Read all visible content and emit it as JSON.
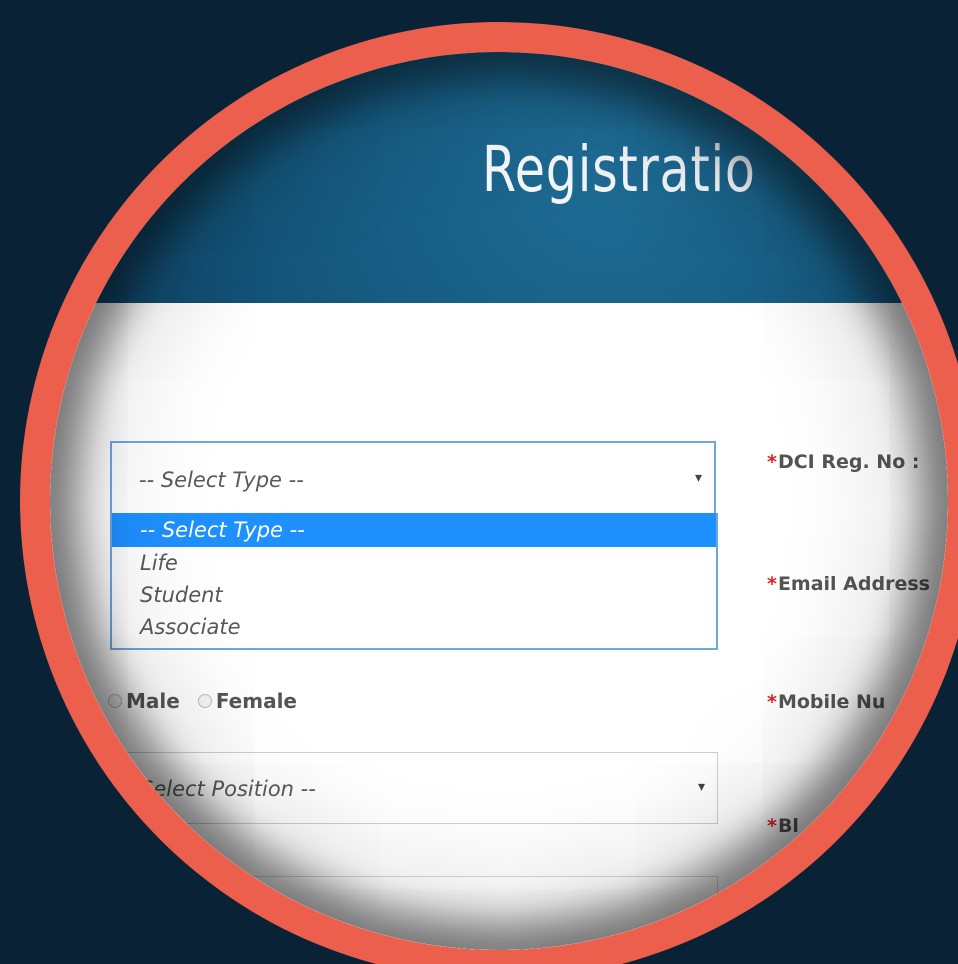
{
  "page": {
    "title": "Registratio"
  },
  "form": {
    "membership_type": {
      "placeholder": "-- Select Type --",
      "options": [
        "-- Select Type --",
        "Life",
        "Student",
        "Associate"
      ]
    },
    "gender": {
      "options": [
        "Male",
        "Female"
      ]
    },
    "position": {
      "placeholder": "Select Position --"
    },
    "fields": {
      "dci_reg_no": "DCI Reg. No :",
      "email_address": "Email Address",
      "mobile_number": "Mobile Nu",
      "blood_group_partial": "Bl"
    },
    "required_mark": "*"
  },
  "colors": {
    "background": "#0a2235",
    "ring": "#ec5f4d",
    "header": "#165a80",
    "selected_option": "#1e90ff",
    "required": "#e02020"
  },
  "icons": {
    "dropdown_caret": "▾"
  }
}
